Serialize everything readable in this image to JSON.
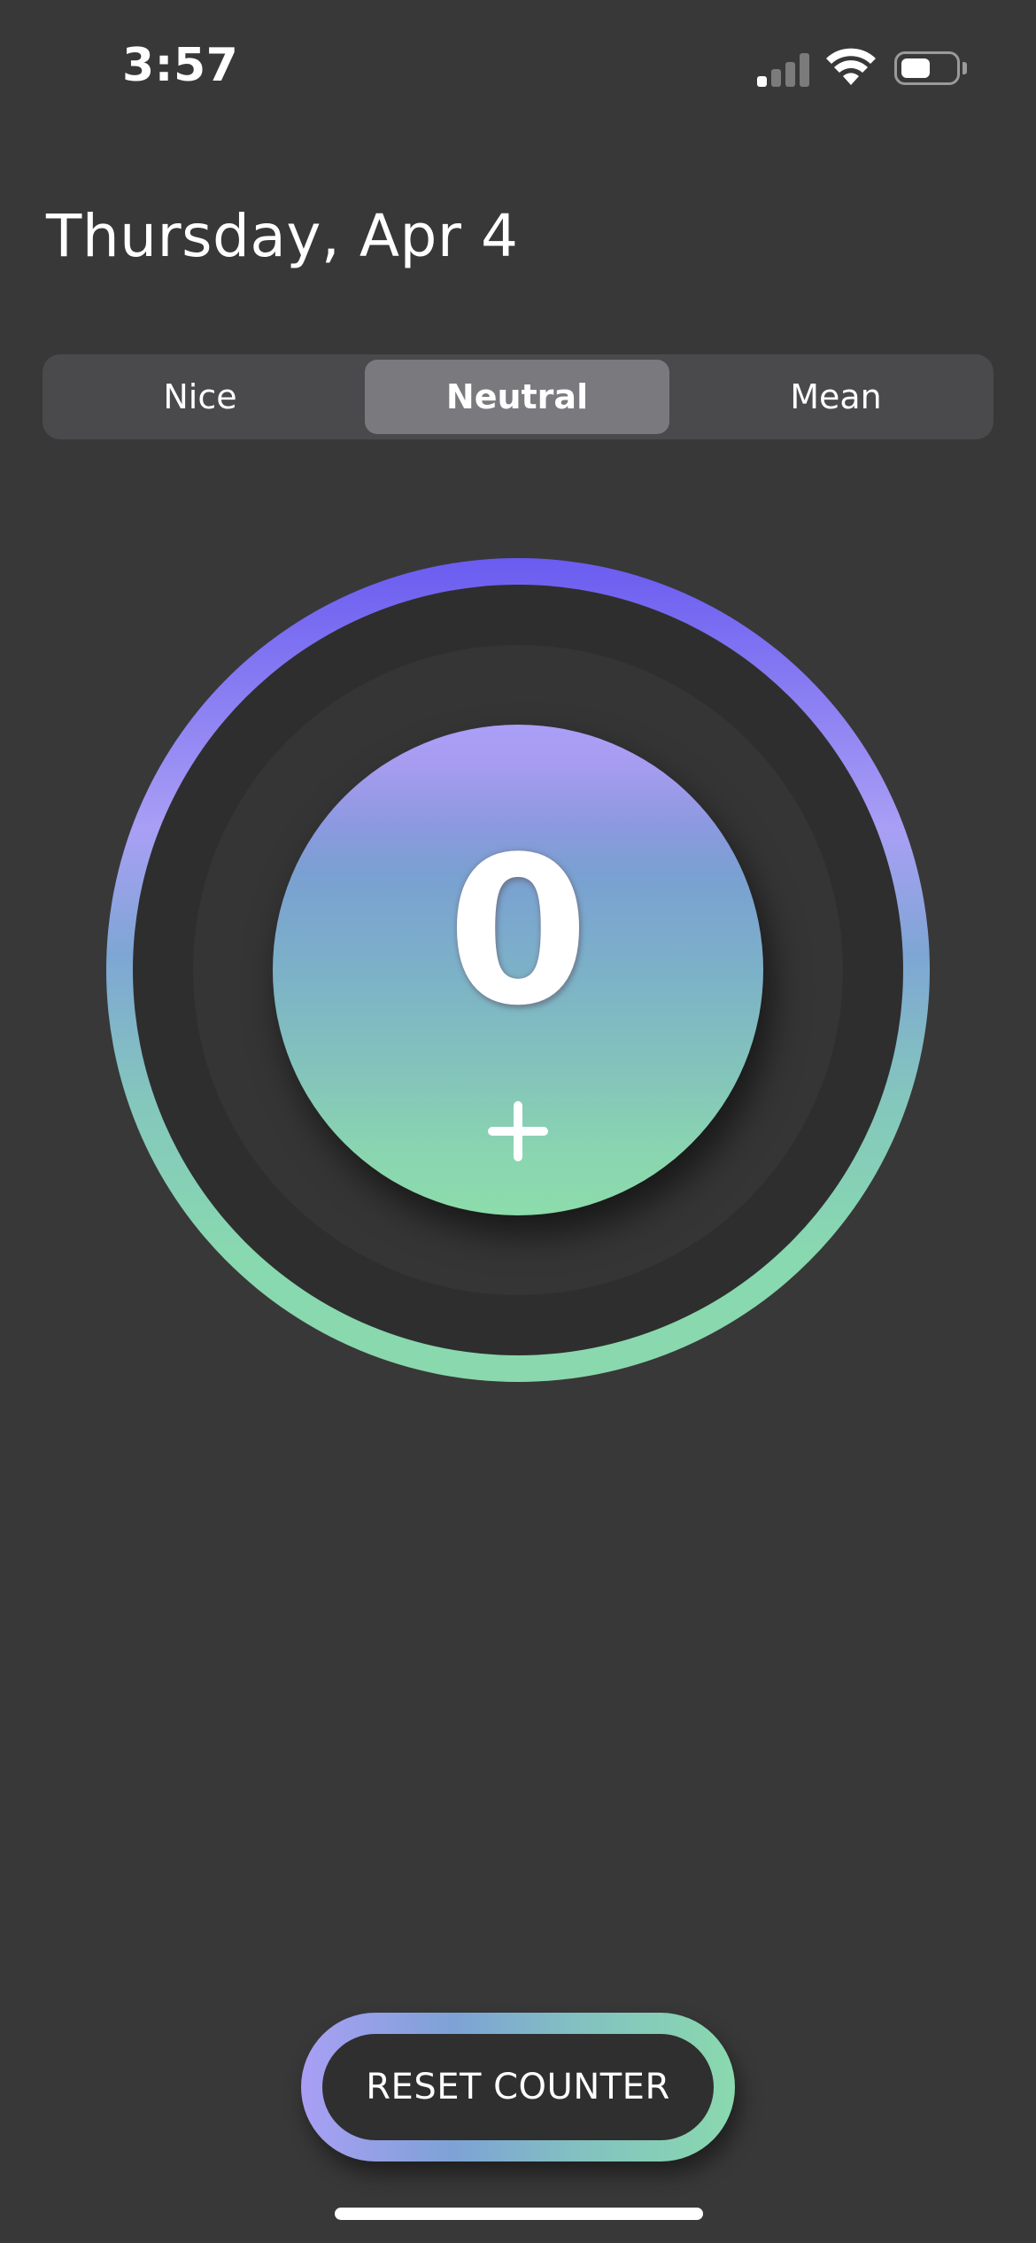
{
  "status_bar": {
    "time": "3:57",
    "signal_strength": "1 of 4 bars",
    "wifi_icon": "wifi-icon",
    "battery_icon": "battery-icon",
    "battery_level": 0.55
  },
  "header": {
    "date": "Thursday, Apr 4"
  },
  "segmented_control": {
    "segments": [
      {
        "label": "Nice",
        "selected": false
      },
      {
        "label": "Neutral",
        "selected": true
      },
      {
        "label": "Mean",
        "selected": false
      }
    ],
    "selected_index": 1
  },
  "counter": {
    "value": "0",
    "increment_icon": "plus-icon"
  },
  "reset": {
    "label": "RESET COUNTER"
  },
  "colors": {
    "background": "#383838",
    "gradient_top": "#6a5cf0",
    "gradient_mid": "#a99ff5",
    "gradient_bottom": "#8ad8ad",
    "segment_selected": "#7a797e",
    "segment_track": "#4a4a4c"
  }
}
